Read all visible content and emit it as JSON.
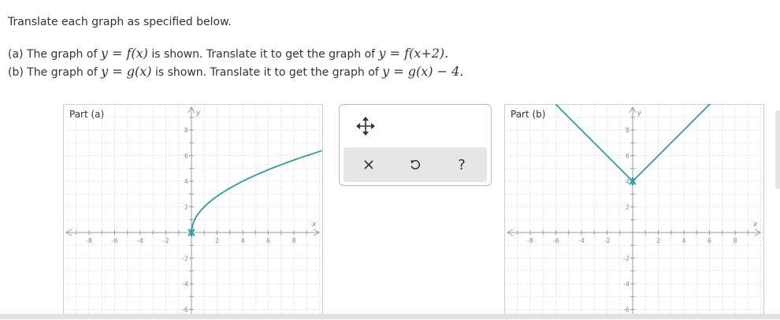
{
  "instructions": "Translate each graph as specified below.",
  "part_a": {
    "prefix": "(a) The graph of",
    "given_fn": "y = f(x)",
    "mid": "is shown. Translate it to get the graph of",
    "target_fn": "y = f(x+2)."
  },
  "part_b": {
    "prefix": "(b) The graph of",
    "given_fn": "y = g(x)",
    "mid": "is shown. Translate it to get the graph of",
    "target_fn": "y = g(x) − 4."
  },
  "graphs": {
    "a": {
      "label": "Part (a)",
      "x_axis_label": "x",
      "y_axis_label": "y",
      "x_ticks": [
        "-8",
        "-6",
        "-4",
        "-2",
        "2",
        "4",
        "6",
        "8"
      ],
      "y_ticks": [
        "8",
        "6",
        "4",
        "2",
        "-2",
        "-4",
        "-6"
      ],
      "curve": {
        "type": "sqrt",
        "start": [
          0,
          0
        ],
        "points": [
          [
            0,
            0
          ],
          [
            2,
            2.8
          ],
          [
            4,
            4
          ],
          [
            6,
            4.9
          ],
          [
            8,
            5.66
          ],
          [
            10,
            6.3
          ]
        ]
      },
      "curve_color": "#2a9dad"
    },
    "b": {
      "label": "Part (b)",
      "x_axis_label": "x",
      "y_axis_label": "y",
      "x_ticks": [
        "-8",
        "-6",
        "-4",
        "-2",
        "2",
        "4",
        "6",
        "8"
      ],
      "y_ticks": [
        "8",
        "6",
        "4",
        "2",
        "-2",
        "-4",
        "-6"
      ],
      "curve": {
        "type": "abs",
        "vertex": [
          0,
          4
        ],
        "points": [
          [
            -6,
            10
          ],
          [
            0,
            4
          ],
          [
            7,
            11
          ]
        ]
      },
      "curve_color": "#2a9dad"
    }
  },
  "toolbox": {
    "move_icon": "move-arrows-icon",
    "clear_icon": "x-icon",
    "undo_icon": "undo-icon",
    "help_label": "?"
  }
}
